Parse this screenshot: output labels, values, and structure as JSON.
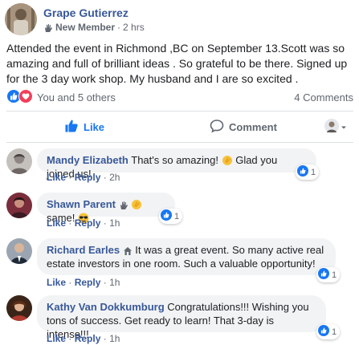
{
  "post": {
    "author": "Grape Gutierrez",
    "badge": "New Member",
    "separator": "·",
    "time": "2 hrs",
    "text": "Attended the event in Richmond ,BC on September 13.Scott was so amazing and full of brilliant ideas . So grateful to be there. Signed up for the 3 day work shop. My husband and I are so excited .",
    "reactions_text": "You and 5 others",
    "comments_text": "4 Comments"
  },
  "actions": {
    "like": "Like",
    "comment": "Comment"
  },
  "comments": [
    {
      "name": "Mandy Elizabeth",
      "text_before": "That's so amazing!",
      "text_after": "Glad you joined us!",
      "like_label": "Like",
      "dot": "·",
      "reply_label": "Reply",
      "time": "2h",
      "reaction_count": "1"
    },
    {
      "name": "Shawn Parent",
      "text": "same!",
      "like_label": "Like",
      "dot": "·",
      "reply_label": "Reply",
      "time": "1h",
      "reaction_count": "1"
    },
    {
      "name": "Richard Earles",
      "text": "It was a great event. So many active real estate investors in one room. Such a valuable opportunity!",
      "like_label": "Like",
      "dot": "·",
      "reply_label": "Reply",
      "time": "1h",
      "reaction_count": "1"
    },
    {
      "name": "Kathy Van Dokkumburg",
      "text": "Congratulations!!! Wishing you tons of success. Get ready to learn! That 3-day is intense!!!",
      "like_label": "Like",
      "dot": "·",
      "reply_label": "Reply",
      "time": "1h",
      "reaction_count": "1"
    }
  ],
  "colors": {
    "link_blue": "#385898",
    "like_blue": "#1877f2",
    "love_red": "#f33e58",
    "muted": "#606770",
    "bubble": "#f2f3f5"
  },
  "icons": {
    "badge": "wave-hand-icon",
    "reactions": [
      "like-reaction-icon",
      "love-reaction-icon"
    ],
    "like_action": "thumbs-up-icon",
    "comment_action": "speech-bubble-icon",
    "audience": "audience-avatar-icon"
  }
}
